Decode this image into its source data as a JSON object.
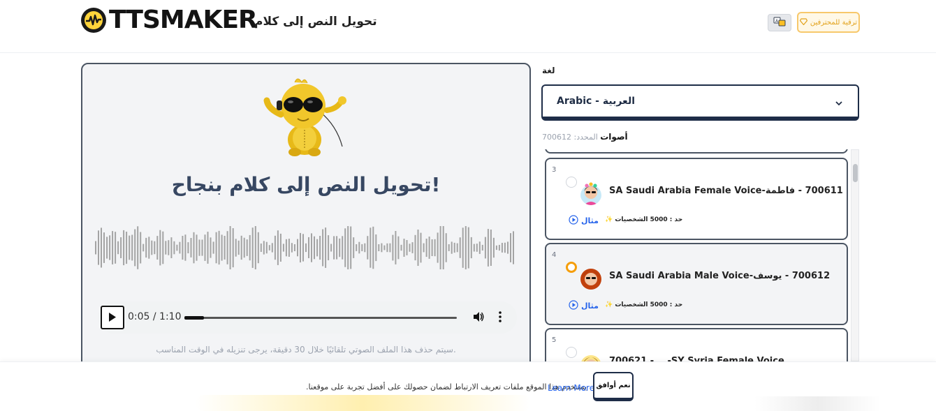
{
  "header": {
    "logo_text": "TTSMAKER",
    "title": "تحويل النص إلى كلام",
    "upgrade_label": "ترقية للمحترفين"
  },
  "result": {
    "success_title": "!تحويل النص إلى كلام بنجاح",
    "audio": {
      "current_time": "0:05",
      "duration": "1:10",
      "time_display": "0:05 / 1:10",
      "progress": 0.071
    },
    "expire_note": ".سيتم حذف هذا الملف الصوتي تلقائيًا خلال 30 دقيقة، يرجى تنزيله في الوقت المناسب"
  },
  "language": {
    "label": "لغة",
    "selected": "العربية - Arabic"
  },
  "voices": {
    "label": "أصوات",
    "selected_prefix": "المحدد:",
    "selected_id": "700612",
    "items": [
      {
        "num": "3",
        "name": "700611 - فاطمة-SA Saudi Arabia Female Voice",
        "limit": "حد : 5000 الشخصيات",
        "sample": "مثال",
        "selected": false
      },
      {
        "num": "4",
        "name": "700612 - يوسف-SA Saudi Arabia Male Voice",
        "limit": "حد : 5000 الشخصيات",
        "sample": "مثال",
        "selected": true
      },
      {
        "num": "5",
        "name": "700621 - ...-SY Syria Female Voice",
        "limit": "",
        "sample": "",
        "selected": false
      }
    ]
  },
  "cookie": {
    "text": "يستخدم هذا الموقع ملفات تعريف الارتباط لضمان حصولك على أفضل تجربة على موقعنا.",
    "learn_more": "Learn More",
    "accept": "نعم أوافق"
  },
  "colors": {
    "accent_navy": "#1e2d48",
    "upgrade_gold": "#f7c86b",
    "selected_radio": "#f59e0b",
    "link_blue": "#2563eb"
  }
}
